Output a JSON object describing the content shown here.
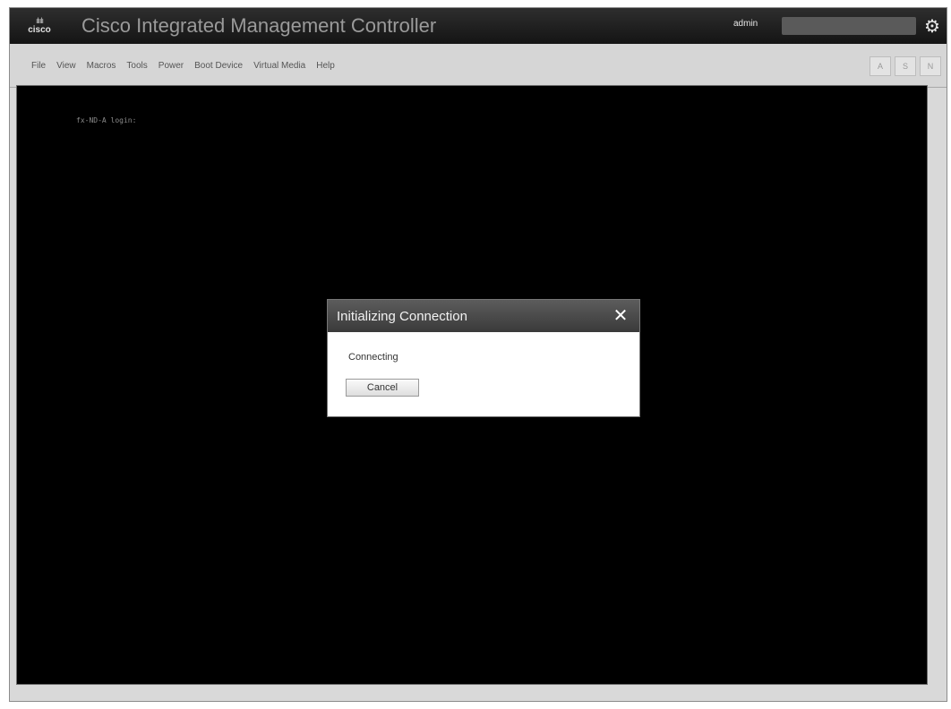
{
  "header": {
    "logo_text": "cisco",
    "title": "Cisco Integrated Management Controller",
    "user": "admin"
  },
  "menu": {
    "items": [
      "File",
      "View",
      "Macros",
      "Tools",
      "Power",
      "Boot Device",
      "Virtual Media",
      "Help"
    ]
  },
  "toolbar": {
    "buttons": [
      "A",
      "S",
      "N"
    ]
  },
  "console": {
    "text": "fx-ND-A login:"
  },
  "dialog": {
    "title": "Initializing Connection",
    "status": "Connecting",
    "cancel_label": "Cancel"
  },
  "icons": {
    "gear": "gear-icon",
    "close": "close-icon"
  }
}
